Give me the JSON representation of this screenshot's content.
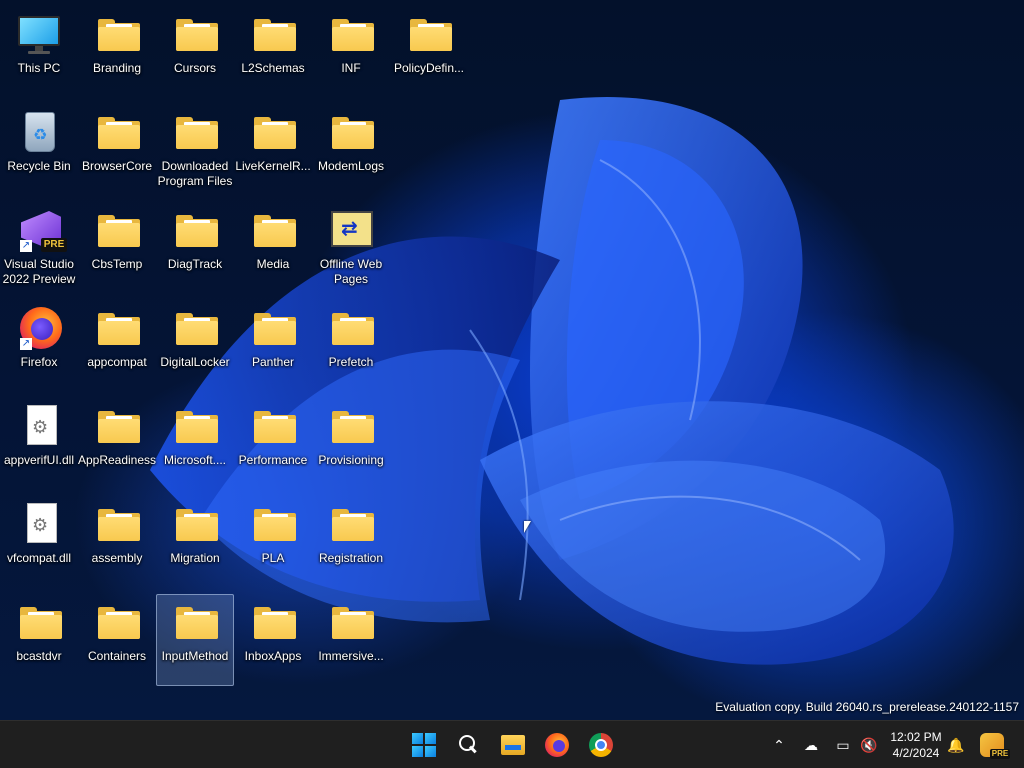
{
  "desktop": {
    "icons": [
      {
        "label": "This PC",
        "kind": "this-pc-icon"
      },
      {
        "label": "Branding",
        "kind": "folder-icon"
      },
      {
        "label": "Cursors",
        "kind": "folder-icon"
      },
      {
        "label": "L2Schemas",
        "kind": "folder-icon"
      },
      {
        "label": "INF",
        "kind": "folder-icon"
      },
      {
        "label": "PolicyDefin...",
        "kind": "folder-icon"
      },
      {
        "label": "Recycle Bin",
        "kind": "recycle-bin-icon"
      },
      {
        "label": "BrowserCore",
        "kind": "folder-icon"
      },
      {
        "label": "Downloaded Program Files",
        "kind": "folder-icon"
      },
      {
        "label": "LiveKernelR...",
        "kind": "folder-icon"
      },
      {
        "label": "ModemLogs",
        "kind": "folder-icon"
      },
      {
        "label": "Visual Studio 2022 Preview",
        "kind": "visual-studio-icon",
        "badge": "PRE"
      },
      {
        "label": "CbsTemp",
        "kind": "folder-icon"
      },
      {
        "label": "DiagTrack",
        "kind": "folder-icon"
      },
      {
        "label": "Media",
        "kind": "folder-icon"
      },
      {
        "label": "Offline Web Pages",
        "kind": "offline-web-pages-icon"
      },
      {
        "label": "Firefox",
        "kind": "firefox-icon"
      },
      {
        "label": "appcompat",
        "kind": "folder-icon"
      },
      {
        "label": "DigitalLocker",
        "kind": "folder-icon"
      },
      {
        "label": "Panther",
        "kind": "folder-icon"
      },
      {
        "label": "Prefetch",
        "kind": "folder-icon"
      },
      {
        "label": "appverifUI.dll",
        "kind": "dll-file-icon"
      },
      {
        "label": "AppReadiness",
        "kind": "folder-icon"
      },
      {
        "label": "Microsoft....",
        "kind": "folder-icon"
      },
      {
        "label": "Performance",
        "kind": "folder-icon"
      },
      {
        "label": "Provisioning",
        "kind": "folder-icon"
      },
      {
        "label": "vfcompat.dll",
        "kind": "dll-file-icon"
      },
      {
        "label": "assembly",
        "kind": "folder-icon"
      },
      {
        "label": "Migration",
        "kind": "folder-icon"
      },
      {
        "label": "PLA",
        "kind": "folder-icon"
      },
      {
        "label": "Registration",
        "kind": "folder-icon"
      },
      {
        "label": "bcastdvr",
        "kind": "folder-icon"
      },
      {
        "label": "Containers",
        "kind": "folder-icon"
      },
      {
        "label": "InputMethod",
        "kind": "folder-icon",
        "selected": true
      },
      {
        "label": "InboxApps",
        "kind": "folder-icon"
      },
      {
        "label": "Immersive...",
        "kind": "folder-icon"
      }
    ],
    "watermark": "Evaluation copy. Build 26040.rs_prerelease.240122-1157"
  },
  "taskbar": {
    "pinned": [
      "windows-start-icon",
      "search-icon",
      "file-explorer-icon",
      "firefox-icon",
      "chrome-icon"
    ],
    "tray": [
      "chevron-up-icon",
      "onedrive-offline-icon",
      "network-icon",
      "volume-muted-icon",
      "notification-bell-icon"
    ],
    "time": "12:02 PM",
    "date": "4/2/2024",
    "copilot_badge": "PRE"
  },
  "colors": {
    "taskbar_bg": "#1f1f1f",
    "folder_yellow": "#f8c94f",
    "wallpaper_blue": "#0a3fd8"
  }
}
